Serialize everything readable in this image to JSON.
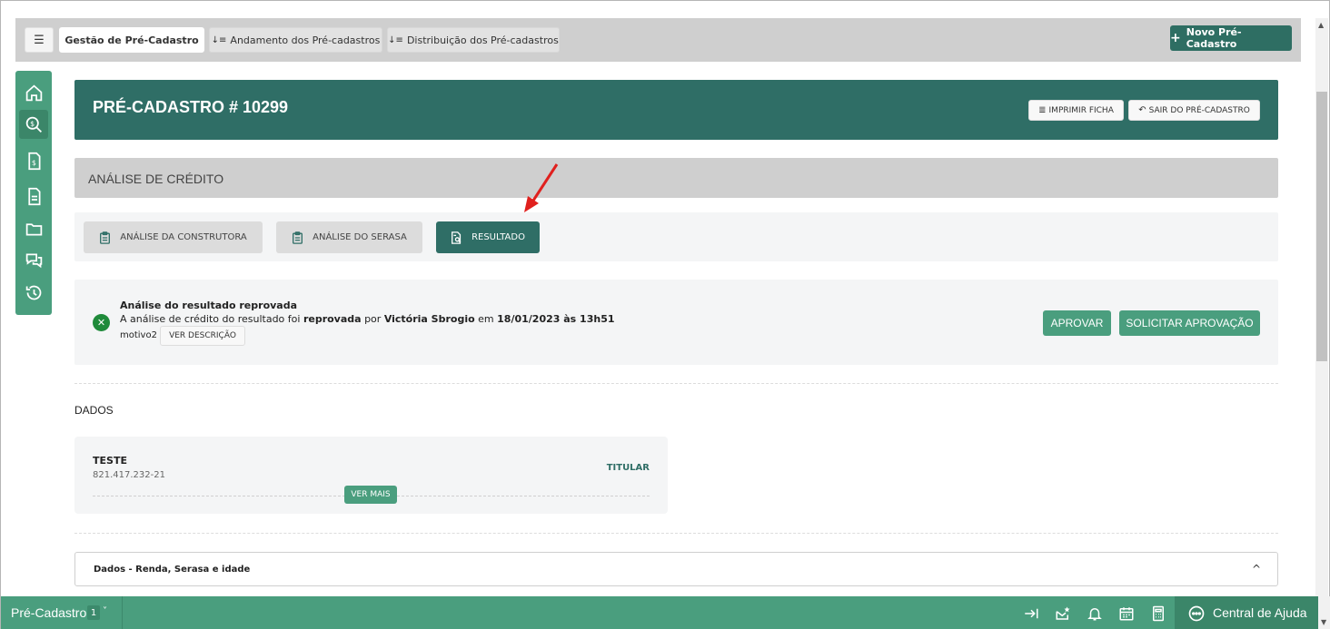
{
  "topbar": {
    "menu_icon": "hamburger-icon",
    "tabs": [
      {
        "label": "Gestão de Pré-Cadastro",
        "active": true
      },
      {
        "label": "Andamento dos Pré-cadastros",
        "icon": "sort-icon"
      },
      {
        "label": "Distribuição dos Pré-cadastros",
        "icon": "sort-icon"
      }
    ],
    "new_button": {
      "plus": "+",
      "label": "Novo Pré-Cadastro"
    }
  },
  "sidebar": {
    "items": [
      "home-icon",
      "search-money-icon",
      "money-document-icon",
      "document-icon",
      "folder-icon",
      "chat-icon",
      "history-icon"
    ],
    "active_index": 1
  },
  "header": {
    "title": "PRÉ-CADASTRO # 10299",
    "print_label": "IMPRIMIR FICHA",
    "exit_label": "SAIR DO PRÉ-CADASTRO"
  },
  "section": {
    "title": "ANÁLISE DE CRÉDITO"
  },
  "analysis_tabs": [
    {
      "label": "ANÁLISE DA CONSTRUTORA",
      "active": false
    },
    {
      "label": "ANÁLISE DO SERASA",
      "active": false
    },
    {
      "label": "RESULTADO",
      "active": true
    }
  ],
  "result": {
    "title": "Análise do resultado reprovada",
    "line_part1": "A análise de crédito do resultado foi ",
    "line_status": "reprovada",
    "line_part2": " por ",
    "line_user": "Victória Sbrogio",
    "line_part3": " em ",
    "line_date": "18/01/2023 às 13h51",
    "motivo": "motivo2",
    "ver_descricao": "VER DESCRIÇÃO",
    "approve_label": "APROVAR",
    "request_label": "SOLICITAR APROVAÇÃO"
  },
  "dados": {
    "label": "DADOS",
    "person": {
      "name": "TESTE",
      "cpf": "821.417.232-21",
      "role": "TITULAR",
      "ver_mais": "VER MAIS"
    }
  },
  "accordion": {
    "label": "Dados - Renda, Serasa e idade",
    "chevron": "^"
  },
  "bottombar": {
    "title": "Pré-Cadastro",
    "badge": "1",
    "chevron": "˅",
    "icons": [
      "arrow-to-right-icon",
      "mail-star-icon",
      "bell-icon",
      "calendar-icon",
      "calculator-icon"
    ],
    "help_label": "Central de Ajuda"
  },
  "colors": {
    "primary_dark": "#2f6e66",
    "primary": "#4a9e7e",
    "error_green": "#1f8a3a",
    "arrow_red": "#e0201e"
  }
}
